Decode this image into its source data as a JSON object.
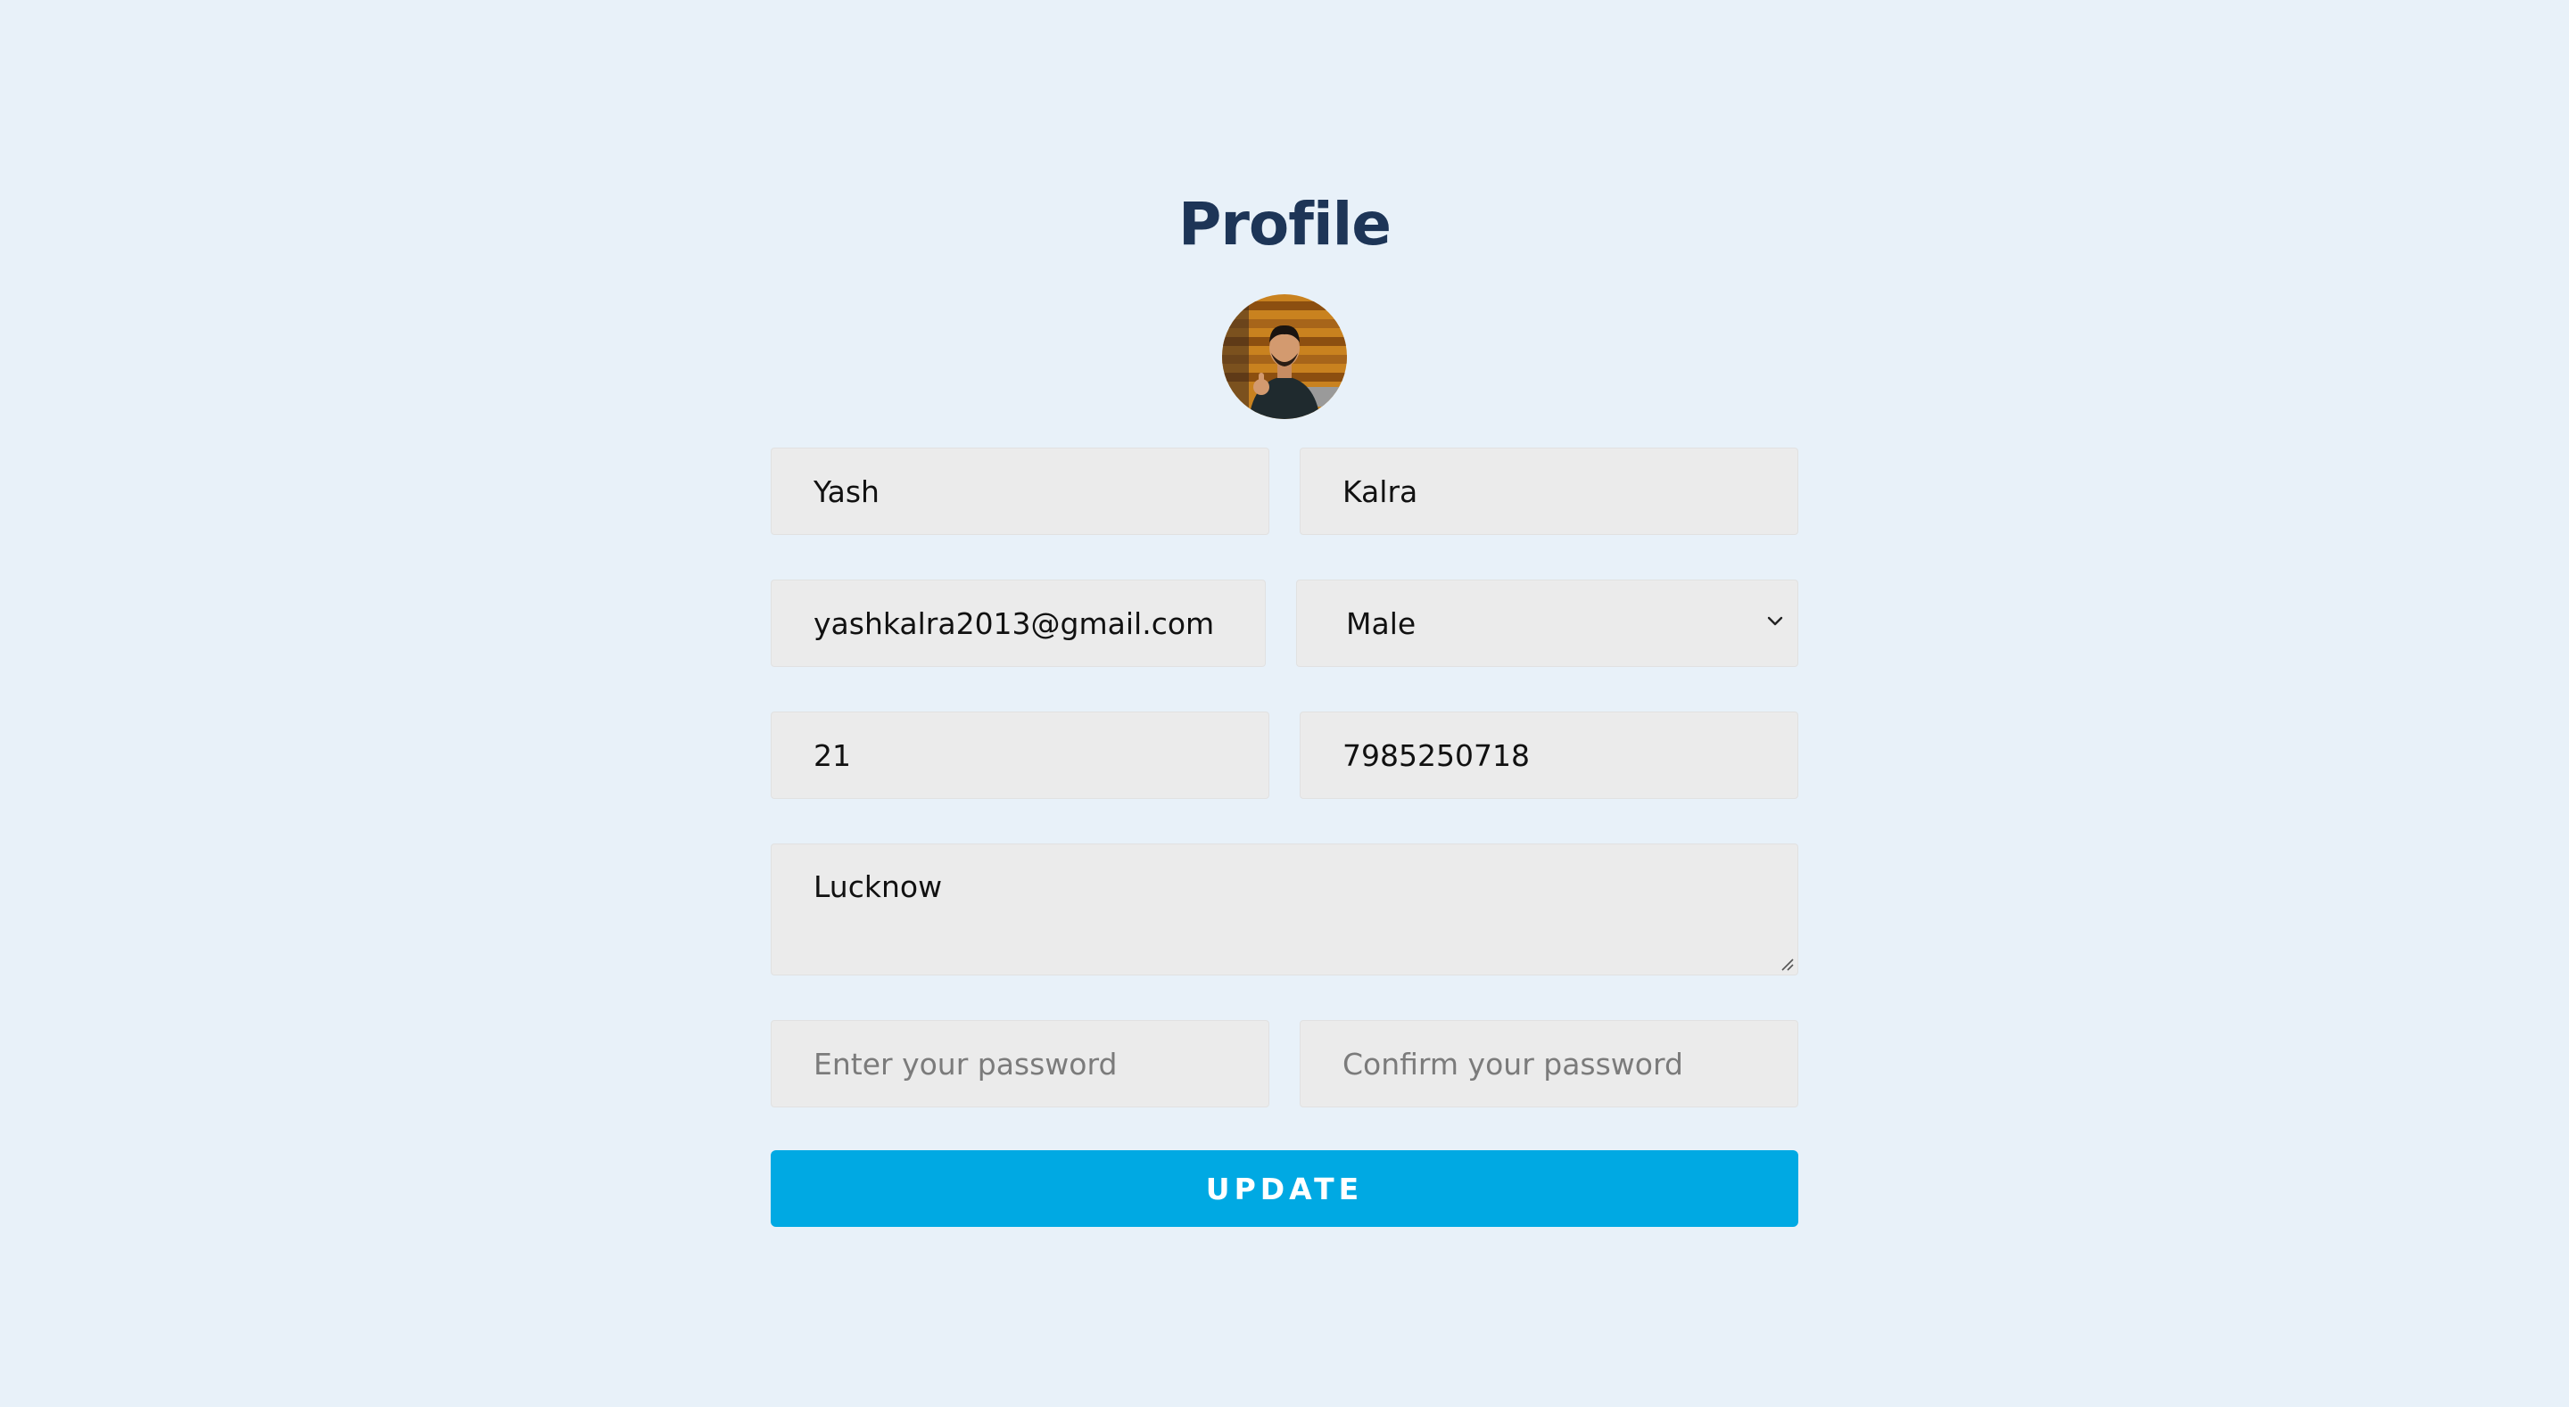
{
  "page": {
    "title": "Profile"
  },
  "form": {
    "first_name": "Yash",
    "last_name": "Kalra",
    "email": "yashkalra2013@gmail.com",
    "gender": "Male",
    "age": "21",
    "phone": "7985250718",
    "address": "Lucknow",
    "password_placeholder": "Enter your password",
    "confirm_password_placeholder": "Confirm your password",
    "update_label": "UPDATE"
  },
  "colors": {
    "background": "#e8f1f9",
    "title": "#1d3557",
    "field_bg": "#ebebeb",
    "button": "#00a9e3"
  },
  "icons": {
    "gender_dropdown": "chevron-down-icon",
    "address_resize": "resize-handle-icon"
  }
}
